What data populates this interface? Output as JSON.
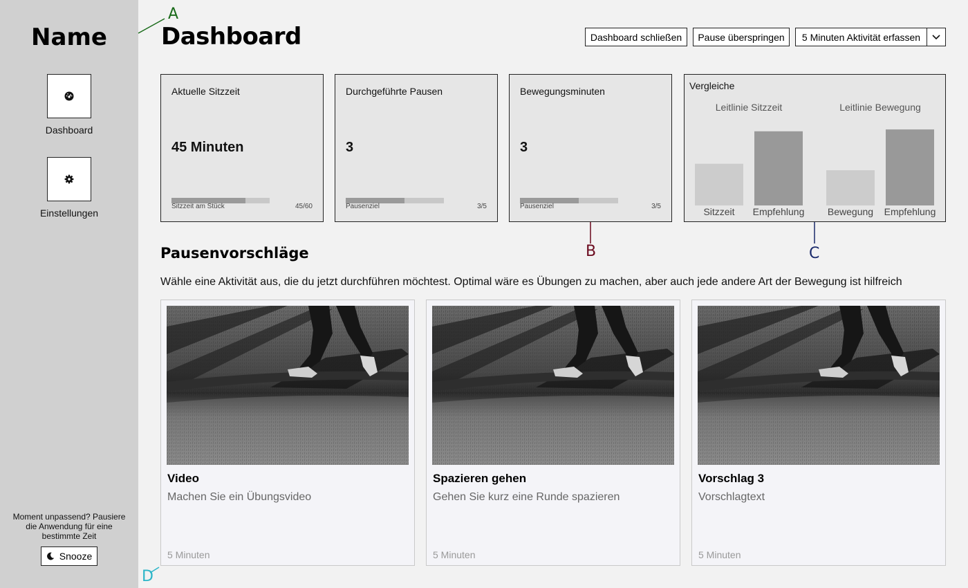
{
  "sidebar": {
    "app_name": "Name",
    "items": [
      {
        "label": "Dashboard",
        "icon": "dashboard-gauge-icon"
      },
      {
        "label": "Einstellungen",
        "icon": "gear-icon"
      }
    ],
    "snooze_text": "Moment unpassend? Pausiere die Anwendung für eine bestimmte Zeit",
    "snooze_label": "Snooze",
    "snooze_icon": "moon-icon"
  },
  "header": {
    "title": "Dashboard",
    "buttons": {
      "close": "Dashboard schließen",
      "skip": "Pause überspringen",
      "log": "5 Minuten Aktivität erfassen"
    },
    "dropdown_icon": "chevron-down-icon"
  },
  "stats": [
    {
      "title": "Aktuelle Sitzzeit",
      "value": "45 Minuten",
      "foot_label": "Sitzzeit am Stück",
      "foot_value": "45/60",
      "progress": 0.75
    },
    {
      "title": "Durchgeführte Pausen",
      "value": "3",
      "foot_label": "Pausenziel",
      "foot_value": "3/5",
      "progress": 0.6
    },
    {
      "title": "Bewegungsminuten",
      "value": "3",
      "foot_label": "Pausenziel",
      "foot_value": "3/5",
      "progress": 0.6
    }
  ],
  "chart_data": {
    "type": "bar",
    "title": "Vergleiche",
    "groups": [
      {
        "name": "Leitlinie Sitzzeit",
        "bars": [
          {
            "label": "Sitzzeit",
            "value": 45
          },
          {
            "label": "Empfehlung",
            "value": 80
          }
        ]
      },
      {
        "name": "Leitlinie Bewegung",
        "bars": [
          {
            "label": "Bewegung",
            "value": 38
          },
          {
            "label": "Empfehlung",
            "value": 82
          }
        ]
      }
    ],
    "colors": {
      "actual": "#cccccc",
      "recommended": "#999999"
    }
  },
  "annotations": {
    "a": "A",
    "b": "B",
    "c": "C",
    "d": "D",
    "a_color": "#1a6b1a",
    "b_color": "#6b0a1e",
    "c_color": "#1a2a6b",
    "d_color": "#2bb5c8"
  },
  "suggestions": {
    "title": "Pausenvorschläge",
    "description": "Wähle eine Aktivität aus, die du jetzt durchführen möchtest. Optimal wäre es Übungen zu machen, aber auch jede andere Art der Bewegung ist hilfreich",
    "cards": [
      {
        "title": "Video",
        "text": "Machen Sie ein Übungsvideo",
        "duration": "5 Minuten"
      },
      {
        "title": "Spazieren gehen",
        "text": "Gehen Sie kurz eine Runde spazieren",
        "duration": "5 Minuten"
      },
      {
        "title": "Vorschlag 3",
        "text": "Vorschlagtext",
        "duration": "5 Minuten"
      }
    ]
  }
}
